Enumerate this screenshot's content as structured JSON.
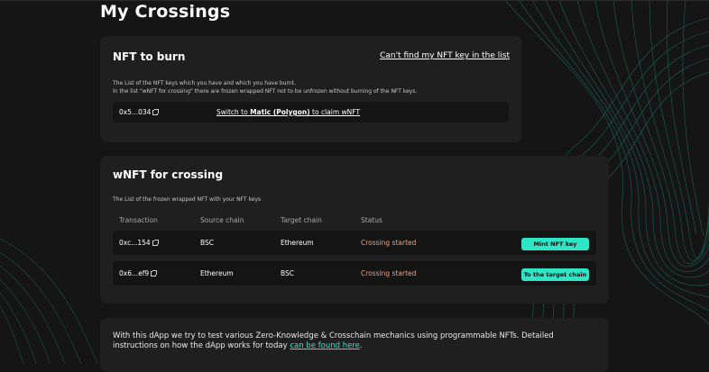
{
  "page": {
    "title": "My Crossings"
  },
  "nft_to_burn": {
    "title": "NFT to burn",
    "cant_find_link": "Can't find my NFT key in the list",
    "description_line1": "The List of the NFT keys which you have and which you have burnt.",
    "description_line2": "In the list \"wNFT for crossing\" there are frozen wrapped NFT not to be unfrozen without burning of the NFT keys.",
    "row": {
      "address": "0x5...034",
      "switch_prefix": "Switch to ",
      "network": "Matic (Polygon)",
      "switch_suffix": " to claim wNFT"
    }
  },
  "wnft_for_crossing": {
    "title": "wNFT for crossing",
    "description": "The List of the frozen wrapped NFT with your NFT keys",
    "columns": [
      "Transaction",
      "Source chain",
      "Target chain",
      "Status"
    ],
    "rows": [
      {
        "transaction": "0xc...154",
        "source": "BSC",
        "target": "Ethereum",
        "status": "Crossing started",
        "action": "Mint NFT key"
      },
      {
        "transaction": "0x6...ef9",
        "source": "Ethereum",
        "target": "BSC",
        "status": "Crossing started",
        "action": "To the target chain"
      }
    ]
  },
  "info": {
    "text": "With this dApp we try to test various Zero-Knowledge & Crosschain mechanics using programmable NFTs. Detailed instructions on how the dApp works for today ",
    "link": "can be found here",
    "suffix": "."
  },
  "colors": {
    "accent": "#2ee5c5",
    "status": "#f2a27a",
    "card": "#1f1f1f",
    "background": "#151515"
  },
  "icons": {
    "external_link": "external-link-icon"
  }
}
